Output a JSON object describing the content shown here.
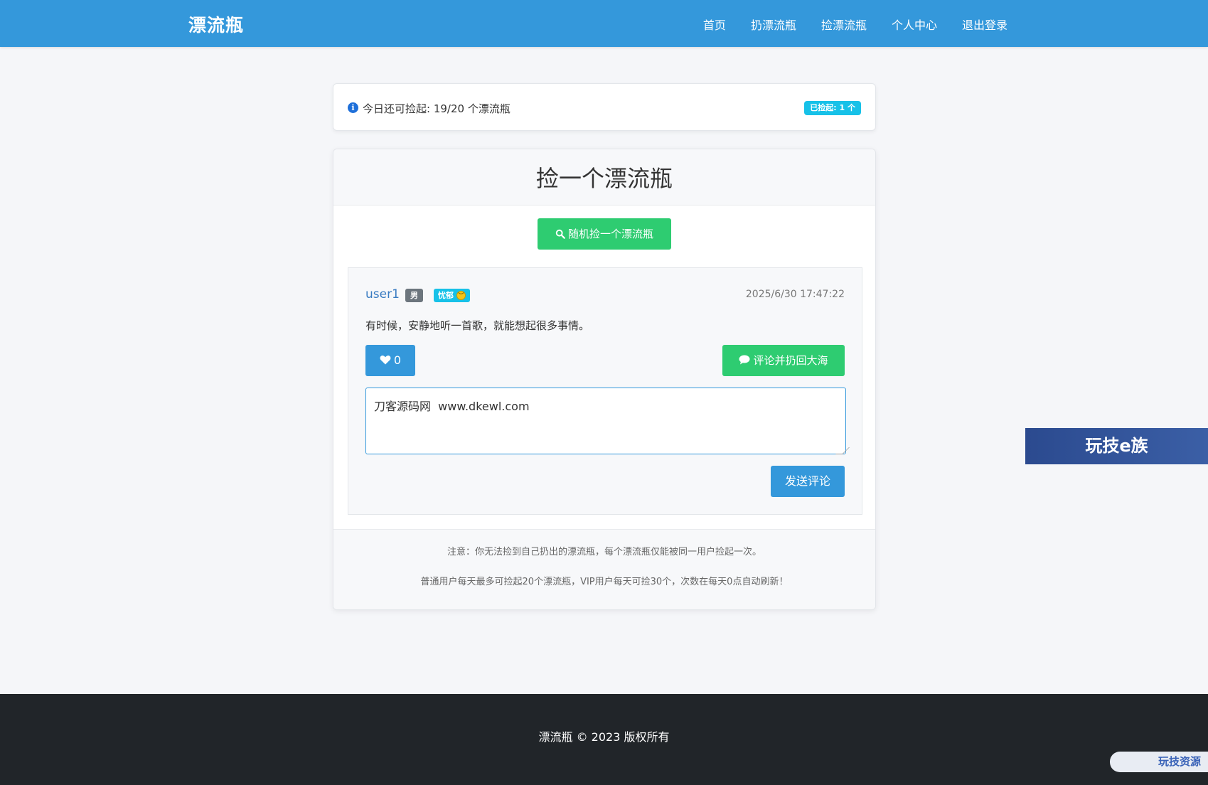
{
  "navbar": {
    "brand": "漂流瓶",
    "links": [
      "首页",
      "扔漂流瓶",
      "捡漂流瓶",
      "个人中心",
      "退出登录"
    ]
  },
  "info": {
    "icon": "info-icon",
    "text": "今日还可捡起: 19/20 个漂流瓶",
    "badge": "已捡起: 1 个"
  },
  "card": {
    "title": "捡一个漂流瓶",
    "random_button": "随机捡一个漂流瓶",
    "random_icon": "search-icon",
    "bottle": {
      "username": "user1",
      "gender": "男",
      "mood": "忧郁",
      "mood_icon": "sad-face-emoji-icon",
      "timestamp": "2025/6/30 17:47:22",
      "content": "有时候，安静地听一首歌，就能想起很多事情。",
      "likes": "0",
      "like_icon": "heart-icon",
      "comment_toss_button": "评论并扔回大海",
      "comment_icon": "comment-icon",
      "comment_value": "刀客源码网  www.dkewl.com",
      "send_button": "发送评论"
    },
    "notes": [
      "注意：你无法捡到自己扔出的漂流瓶，每个漂流瓶仅能被同一用户捡起一次。",
      "普通用户每天最多可捡起20个漂流瓶，VIP用户每天可捡30个，次数在每天0点自动刷新！"
    ]
  },
  "side_banner": "玩技e族",
  "footer": {
    "text": "漂流瓶 © 2023 版权所有"
  },
  "corner_logo": "玩技资源",
  "colors": {
    "primary": "#3498db",
    "success": "#2ecc71",
    "info": "#17c1e8",
    "footer_bg": "#212529"
  }
}
